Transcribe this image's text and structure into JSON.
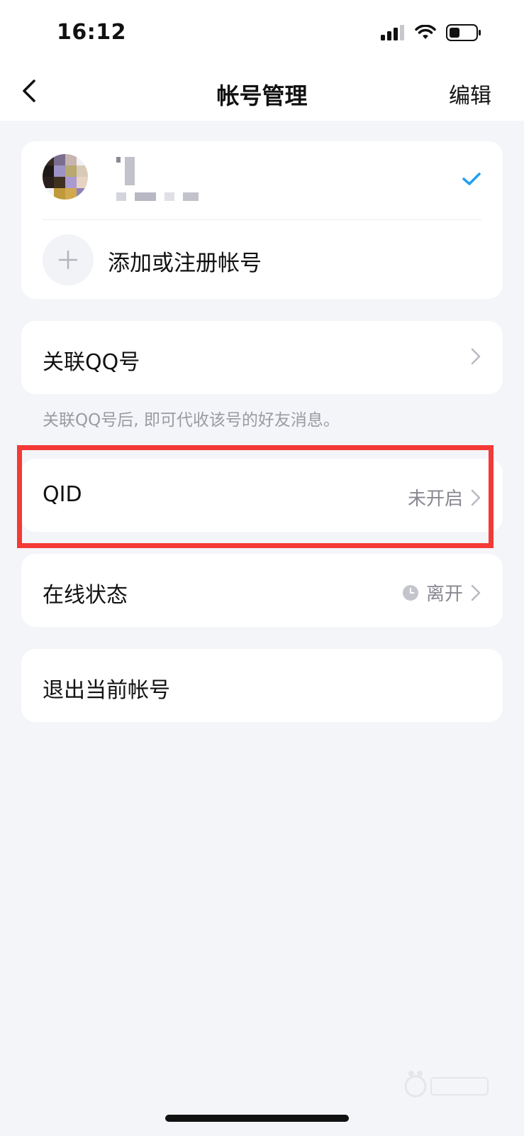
{
  "status_bar": {
    "time": "16:12",
    "icons": [
      "signal-icon",
      "wifi-icon",
      "battery-icon"
    ]
  },
  "nav": {
    "title": "帐号管理",
    "edit_label": "编辑",
    "back_icon": "chevron-left-icon"
  },
  "account": {
    "selected": true,
    "add_label": "添加或注册帐号"
  },
  "rows": {
    "qq": {
      "label": "关联QQ号"
    },
    "qq_hint": "关联QQ号后, 即可代收该号的好友消息。",
    "qid": {
      "label": "QID",
      "value": "未开启"
    },
    "online": {
      "label": "在线状态",
      "value": "离开"
    },
    "logout": {
      "label": "退出当前帐号"
    }
  },
  "colors": {
    "accent": "#1ea0f0",
    "highlight": "#f33a36",
    "background": "#f4f5f9"
  }
}
